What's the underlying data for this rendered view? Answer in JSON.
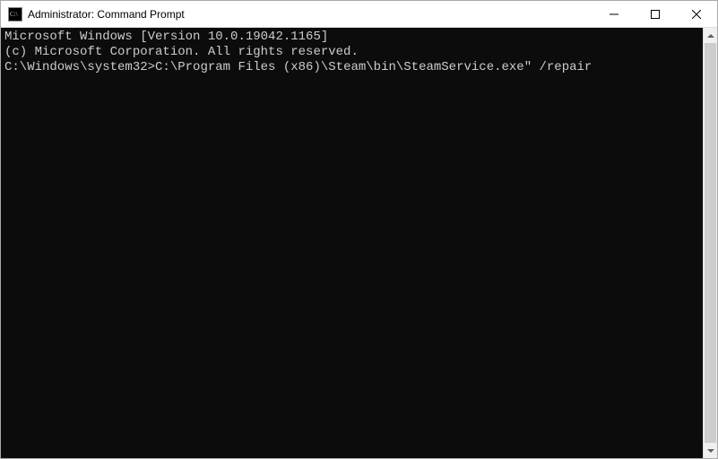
{
  "window": {
    "title": "Administrator: Command Prompt",
    "icon_label": "cmd-icon"
  },
  "terminal": {
    "lines": [
      "Microsoft Windows [Version 10.0.19042.1165]",
      "(c) Microsoft Corporation. All rights reserved.",
      "",
      ""
    ],
    "prompt": "C:\\Windows\\system32>",
    "command": "C:\\Program Files (x86)\\Steam\\bin\\SteamService.exe\" /repair"
  }
}
